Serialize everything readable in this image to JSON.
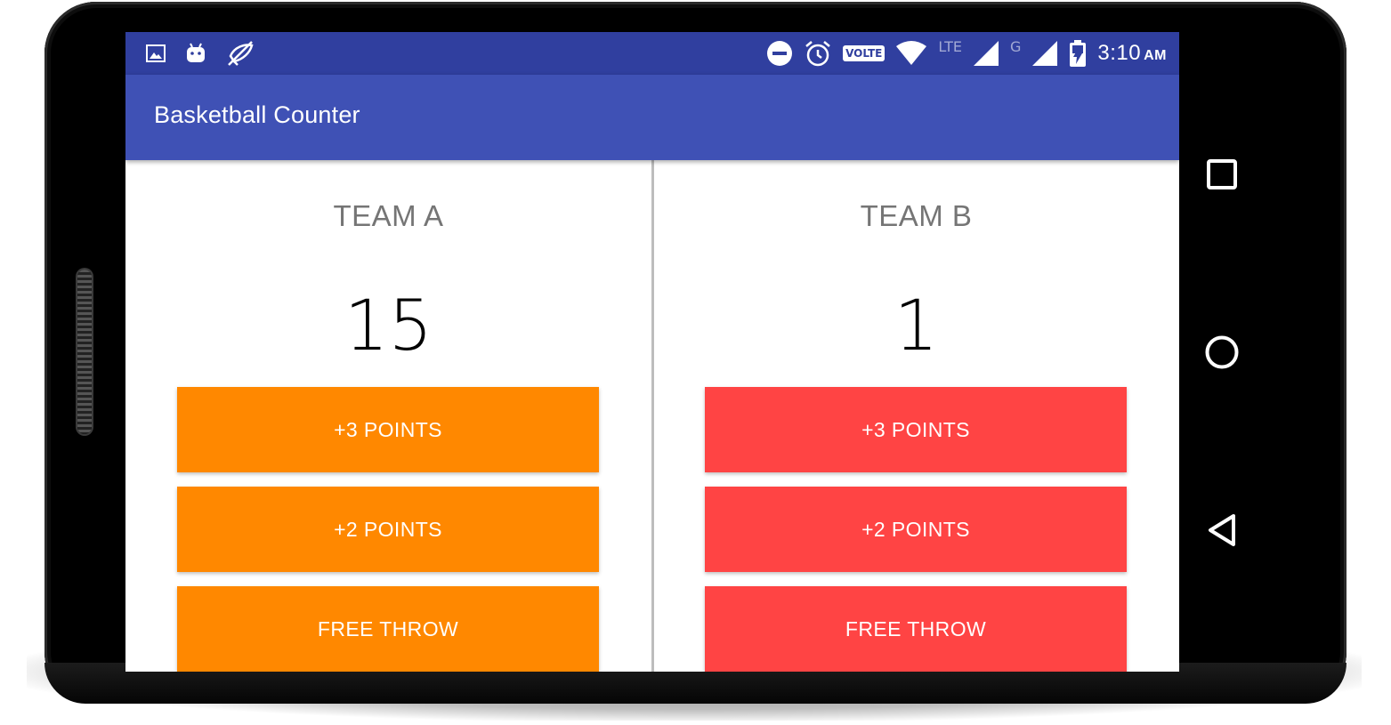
{
  "status_bar": {
    "left_icons": [
      "image-icon",
      "android-icon",
      "muted-mic-icon"
    ],
    "right_icons": [
      "do-not-disturb-icon",
      "alarm-icon",
      "volte-icon",
      "wifi-icon",
      "lte-signal-icon",
      "g-signal-icon",
      "battery-charging-icon"
    ],
    "volte_label": "VOLTE",
    "lte_label": "LTE",
    "g_label": "G",
    "time": "3:10",
    "ampm": "AM",
    "color": "#303f9f"
  },
  "app_bar": {
    "title": "Basketball Counter",
    "color": "#3f51b5"
  },
  "team_a": {
    "name": "TEAM A",
    "score": "15",
    "button_color": "#ff8800",
    "buttons": [
      "+3 POINTS",
      "+2 POINTS",
      "FREE THROW"
    ]
  },
  "team_b": {
    "name": "TEAM B",
    "score": "1",
    "button_color": "#ff4444",
    "buttons": [
      "+3 POINTS",
      "+2 POINTS",
      "FREE THROW"
    ]
  },
  "nav_bar": {
    "icons": [
      "recents-square-icon",
      "home-circle-icon",
      "back-triangle-icon"
    ]
  }
}
